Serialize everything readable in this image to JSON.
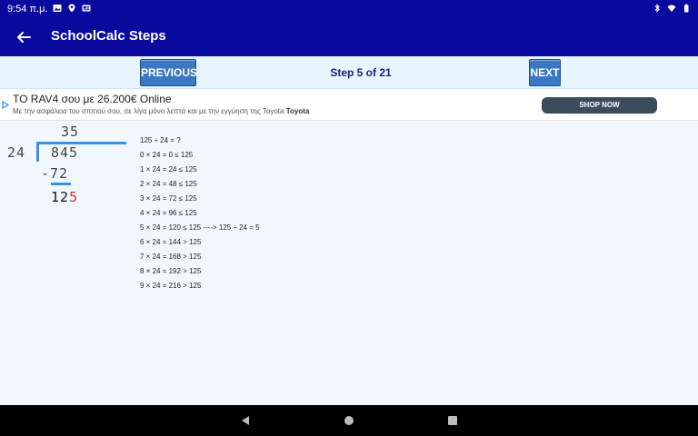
{
  "status_bar": {
    "time": "9:54 π.μ."
  },
  "app_bar": {
    "title": "SchoolCalc Steps"
  },
  "step_nav": {
    "previous_label": "PREVIOUS",
    "step_label": "Step 5 of 21",
    "next_label": "NEXT"
  },
  "ad": {
    "title": "TO RAV4 σου με 26.200€ Online",
    "description": "Με την ασφάλεια του σπιτιού σου, σε λίγα μόνο λεπτά και με την εγγύηση της Toyota",
    "brand": "Toyota",
    "cta": "SHOP NOW"
  },
  "division": {
    "quotient": "35",
    "divisor": "24",
    "dividend": "845",
    "subtraction": "-72",
    "remainder_prefix": "12",
    "remainder_highlight": "5"
  },
  "steps": [
    "125 ÷ 24 = ?",
    "0 × 24 = 0 ≤ 125",
    "1 × 24 = 24 ≤ 125",
    "2 × 24 = 48 ≤ 125",
    "3 × 24 = 72 ≤ 125",
    "4 × 24 = 96 ≤ 125",
    "5 × 24 = 120 ≤ 125 ----> 125 ÷ 24 = 5",
    "6 × 24 = 144 > 125",
    "7 × 24 = 168 > 125",
    "8 × 24 = 192 > 125",
    "9 × 24 = 216 > 125"
  ],
  "colors": {
    "primary": "#0a0a9e",
    "button": "#3a78c4",
    "accent": "#3f8fe0",
    "highlight": "#d32f2f"
  },
  "icons": {
    "status_left": [
      "image-icon",
      "location-icon",
      "news-icon"
    ],
    "status_right": [
      "bluetooth-icon",
      "wifi-icon",
      "battery-icon"
    ]
  }
}
